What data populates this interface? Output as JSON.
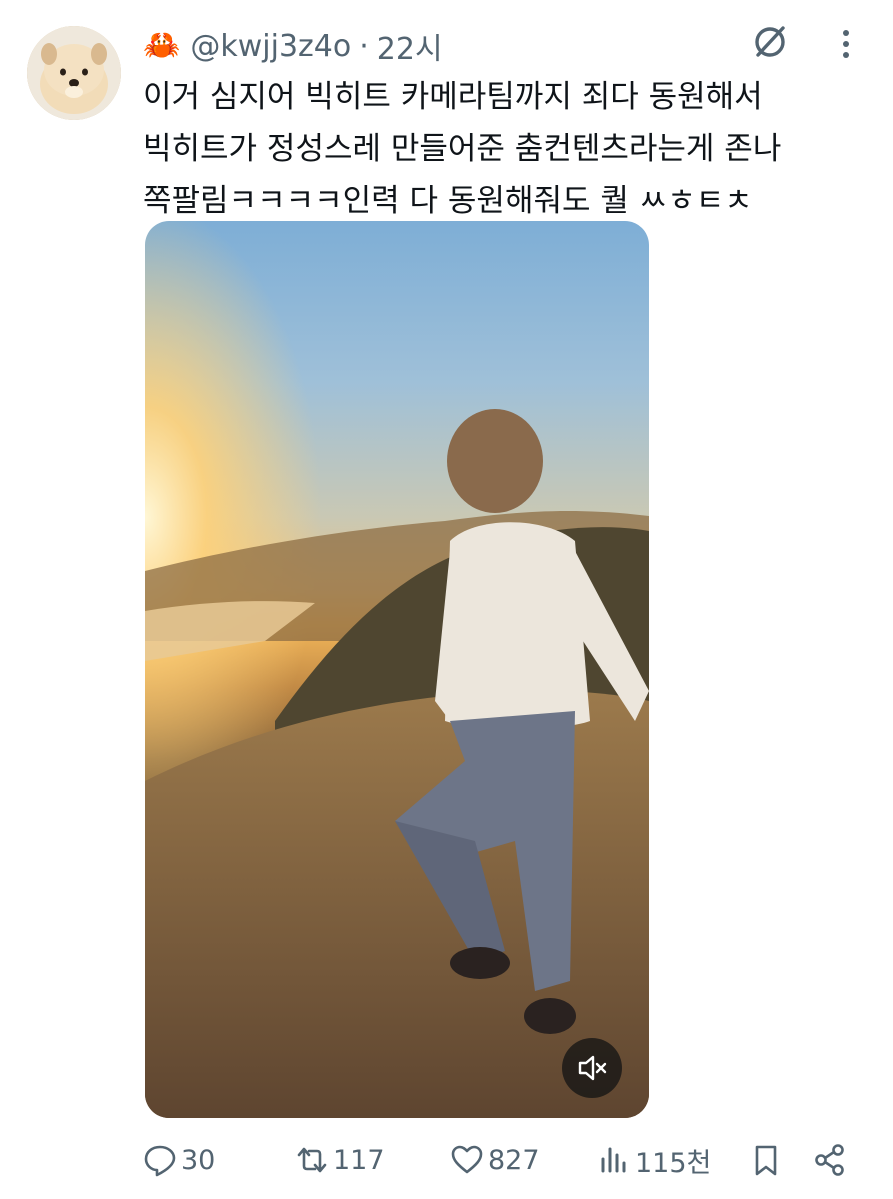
{
  "tweet": {
    "emoji": "🦀",
    "handle": "@kwjj3z4o",
    "separator": "·",
    "time": "22시",
    "text": "이거 심지어 빅히트 카메라팀까지 죄다 동원해서\n빅히트가 정성스레 만들어준 춤컨텐츠라는게 존나\n쪽팔림ㅋㅋㅋㅋ인력 다 동원해줘도 퀄 ㅆㅎㅌㅊ"
  },
  "icons": {
    "grok": "grok-icon",
    "more": "more-icon",
    "mute": "volume-muted-icon",
    "reply": "reply-icon",
    "retweet": "retweet-icon",
    "like": "heart-icon",
    "views": "views-icon",
    "bookmark": "bookmark-icon",
    "share": "share-icon"
  },
  "actions": {
    "replies": "30",
    "retweets": "117",
    "likes": "827",
    "views": "115천"
  },
  "colors": {
    "text": "#0f1419",
    "secondary": "#536471"
  }
}
